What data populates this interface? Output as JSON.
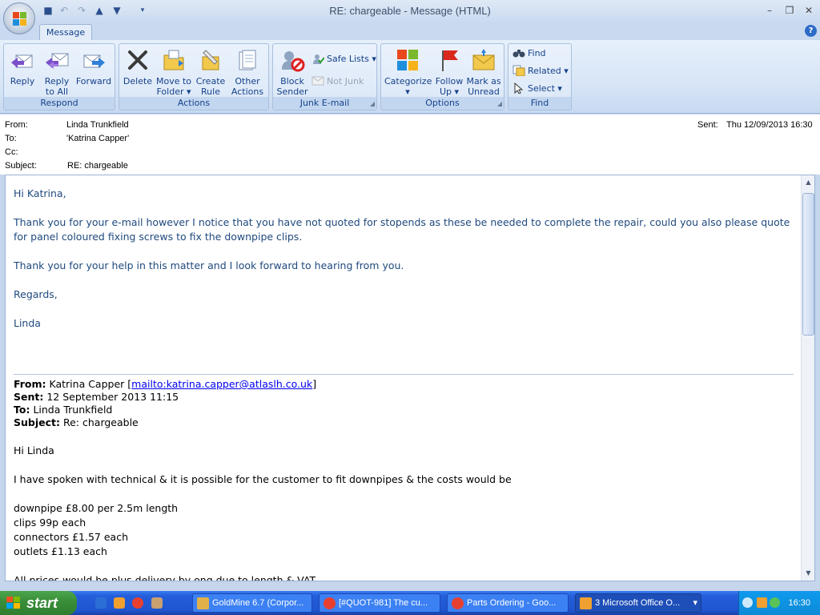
{
  "window": {
    "title": "RE: chargeable - Message (HTML)"
  },
  "quick_access": {
    "icons": [
      "save-icon",
      "undo-icon",
      "redo-icon",
      "previous-item-icon",
      "next-item-icon",
      "customize-dropdown-icon"
    ]
  },
  "ribbon": {
    "tab": "Message",
    "groups": {
      "respond": {
        "label": "Respond",
        "reply": [
          "Reply"
        ],
        "reply_all": [
          "Reply",
          "to All"
        ],
        "forward": [
          "Forward"
        ]
      },
      "actions": {
        "label": "Actions",
        "delete": [
          "Delete"
        ],
        "move_to_folder": [
          "Move to",
          "Folder"
        ],
        "create_rule": [
          "Create",
          "Rule"
        ],
        "other_actions": [
          "Other",
          "Actions"
        ]
      },
      "junk": {
        "label": "Junk E-mail",
        "block_sender": [
          "Block",
          "Sender"
        ],
        "safe_lists": "Safe Lists",
        "not_junk": "Not Junk"
      },
      "options": {
        "label": "Options",
        "categorize": [
          "Categorize"
        ],
        "follow_up": [
          "Follow",
          "Up"
        ],
        "mark_unread": [
          "Mark as",
          "Unread"
        ]
      },
      "find": {
        "label": "Find",
        "find": "Find",
        "related": "Related",
        "select": "Select"
      }
    }
  },
  "header": {
    "from_label": "From:",
    "from": "Linda Trunkfield",
    "to_label": "To:",
    "to": "'Katrina Capper'",
    "cc_label": "Cc:",
    "cc": "",
    "subject_label": "Subject:",
    "subject": "RE: chargeable",
    "sent_label": "Sent:",
    "sent": "Thu 12/09/2013 16:30"
  },
  "body": {
    "reply": [
      "Hi Katrina,",
      "Thank you for your e-mail however I notice that you have not quoted for stopends as these be needed to complete the repair, could you also please quote for panel coloured fixing screws to fix the downpipe clips.",
      "Thank you for your help in this matter and I look forward to hearing from you.",
      "Regards,",
      "Linda"
    ],
    "quoted": {
      "from_label": "From:",
      "from_name": "Katrina Capper [",
      "from_link": "mailto:katrina.capper@atlaslh.co.uk",
      "from_close": "]",
      "sent_label": "Sent:",
      "sent": "12 September 2013 11:15",
      "to_label": "To:",
      "to": "Linda Trunkfield",
      "subject_label": "Subject:",
      "subject": "Re: chargeable",
      "lines": [
        "Hi Linda",
        "I have spoken with technical & it is possible for the customer to fit downpipes & the costs would be",
        "downpipe £8.00 per 2.5m length",
        "clips 99p each",
        "connectors £1.57 each",
        "outlets £1.13 each",
        "All prices would be plus delivery by ong due to length & VAT"
      ]
    }
  },
  "taskbar": {
    "start": "start",
    "tasks": [
      "GoldMine 6.7 (Corpor...",
      "[#QUOT-981] The cu...",
      "Parts Ordering - Goo...",
      "3 Microsoft Office O..."
    ],
    "clock": "16:30"
  },
  "colors": {
    "ribbon_text": "#15428b",
    "body_text": "#1f497d",
    "taskbar": "#245edb",
    "start": "#3a8f3a"
  }
}
